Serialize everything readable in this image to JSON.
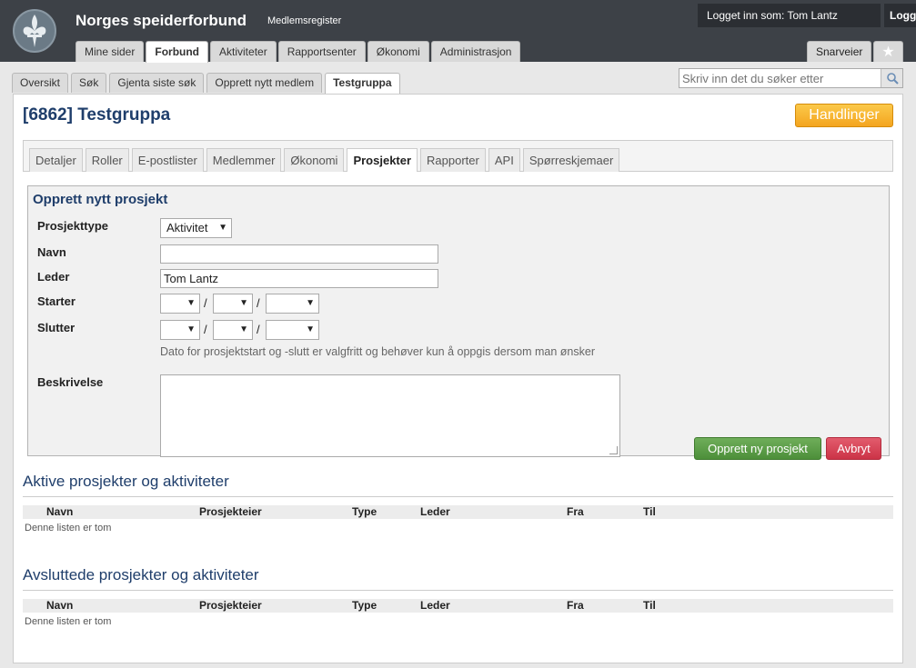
{
  "header": {
    "app_title": "Norges speiderforbund",
    "app_subtitle": "Medlemsregister",
    "user_text": "Logget inn som: Tom Lantz",
    "logout_label": "Logg ut",
    "main_tabs": [
      "Mine sider",
      "Forbund",
      "Aktiviteter",
      "Rapportsenter",
      "Økonomi",
      "Administrasjon"
    ],
    "active_main_tab": "Forbund",
    "shortcuts_label": "Snarveier",
    "logo_icon": "fleur-de-lis-icon",
    "star_icon": "star-icon"
  },
  "subnav": {
    "tabs": [
      "Oversikt",
      "Søk",
      "Gjenta siste søk",
      "Opprett nytt medlem",
      "Testgruppa"
    ],
    "active_tab": "Testgruppa",
    "search_placeholder": "Skriv inn det du søker etter",
    "search_icon": "search-icon"
  },
  "page": {
    "title": "[6862] Testgruppa",
    "actions_label": "Handlinger",
    "tabs": [
      "Detaljer",
      "Roller",
      "E-postlister",
      "Medlemmer",
      "Økonomi",
      "Prosjekter",
      "Rapporter",
      "API",
      "Spørreskjemaer"
    ],
    "active_tab": "Prosjekter"
  },
  "form": {
    "title": "Opprett nytt prosjekt",
    "type_label": "Prosjekttype",
    "type_value": "Aktivitet",
    "name_label": "Navn",
    "name_value": "",
    "leader_label": "Leder",
    "leader_value": "Tom Lantz",
    "start_label": "Starter",
    "end_label": "Slutter",
    "date_separator": "/",
    "date_hint": "Dato for prosjektstart og -slutt er valgfritt og behøver kun å oppgis dersom man ønsker",
    "description_label": "Beskrivelse",
    "create_label": "Opprett ny prosjekt",
    "cancel_label": "Avbryt"
  },
  "active_section": {
    "title": "Aktive prosjekter og aktiviteter",
    "columns": [
      "Navn",
      "Prosjekteier",
      "Type",
      "Leder",
      "Fra",
      "Til"
    ],
    "empty_text": "Denne listen er tom"
  },
  "closed_section": {
    "title": "Avsluttede prosjekter og aktiviteter",
    "columns": [
      "Navn",
      "Prosjekteier",
      "Type",
      "Leder",
      "Fra",
      "Til"
    ],
    "empty_text": "Denne listen er tom"
  },
  "colors": {
    "header_bg": "#3d4147",
    "title_blue": "#1f3e6b",
    "action_orange": "#f4a51f",
    "create_green": "#4d8f3a",
    "cancel_red": "#cc3347"
  }
}
